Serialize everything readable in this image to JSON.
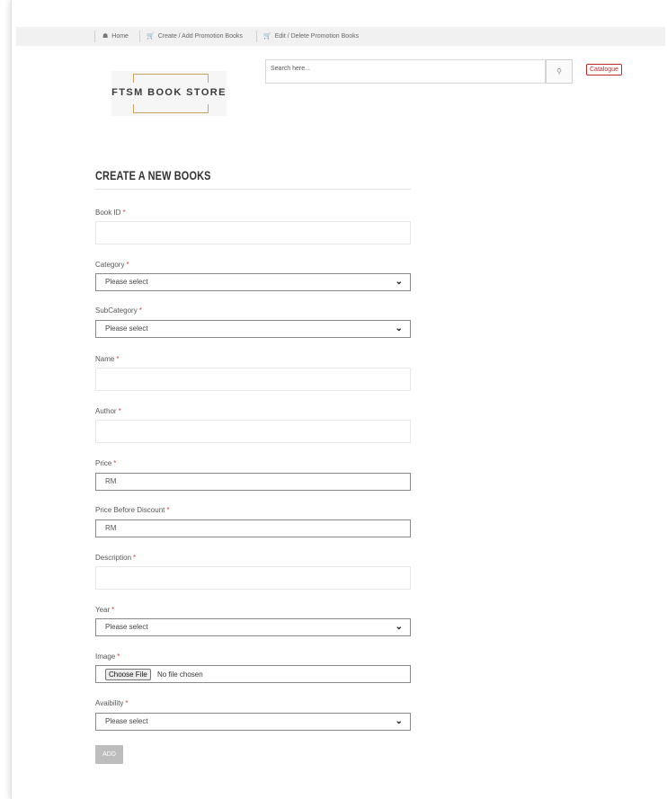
{
  "nav": {
    "items": [
      {
        "icon": "home-icon",
        "label": "Home"
      },
      {
        "icon": "cart-icon",
        "label": "Create / Add Promotion Books"
      },
      {
        "icon": "cart-icon",
        "label": "Edit / Delete Promotion Books"
      }
    ]
  },
  "header": {
    "logo_text": "FTSM BOOK STORE",
    "search_placeholder": "Search here...",
    "search_icon": "search-icon",
    "catalogue_label": "Catalogue"
  },
  "form": {
    "title": "CREATE A NEW BOOKS",
    "required_mark": "*",
    "fields": {
      "book_id": {
        "label": "Book ID",
        "value": ""
      },
      "category": {
        "label": "Category",
        "value": "Please select"
      },
      "subcategory": {
        "label": "SubCategory",
        "value": "Please select"
      },
      "name": {
        "label": "Name",
        "value": ""
      },
      "author": {
        "label": "Author",
        "value": ""
      },
      "price": {
        "label": "Price",
        "value": "RM"
      },
      "price_before": {
        "label": "Price Before Discount",
        "value": "RM"
      },
      "description": {
        "label": "Description",
        "value": ""
      },
      "year": {
        "label": "Year",
        "value": "Please select"
      },
      "image": {
        "label": "Image",
        "button": "Choose File",
        "status": "No file chosen"
      },
      "availability": {
        "label": "Avaibility",
        "value": "Please select"
      }
    },
    "submit_label": "ADD"
  },
  "colors": {
    "accent_red": "#c62828",
    "required_red": "#d84343",
    "logo_gold": "#c9a65b",
    "button_gray": "#bdbdbd"
  }
}
